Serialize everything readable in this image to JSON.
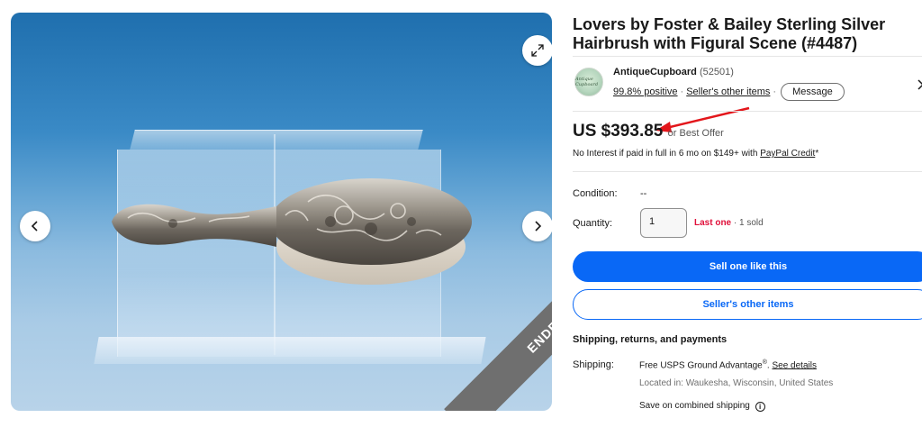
{
  "listing": {
    "title": "Lovers by Foster & Bailey Sterling Silver Hairbrush with Figural Scene (#4487)",
    "ended_label": "ENDED"
  },
  "seller": {
    "name": "AntiqueCupboard",
    "feedback_count": "(52501)",
    "positive": "99.8% positive",
    "separator": "·",
    "other_items_link": "Seller's other items",
    "message_button": "Message",
    "avatar_text": "Antique Cupboard"
  },
  "price": {
    "amount": "US $393.85",
    "best_offer": "or Best Offer",
    "interest_text": "No Interest if paid in full in 6 mo on $149+ with ",
    "paypal_link": "PayPal Credit",
    "asterisk": "*"
  },
  "details": {
    "condition_label": "Condition:",
    "condition_value": "--",
    "quantity_label": "Quantity:",
    "quantity_value": "1",
    "last_one": "Last one",
    "sold_text": " · 1 sold"
  },
  "buttons": {
    "sell_one": "Sell one like this",
    "seller_items": "Seller's other items"
  },
  "shipping": {
    "heading": "Shipping, returns, and payments",
    "shipping_label": "Shipping:",
    "service": "Free USPS Ground Advantage",
    "registered": "®",
    "period": ".",
    "see_details": "See details",
    "location": "Located in: Waukesha, Wisconsin, United States",
    "combined": "Save on combined shipping",
    "info_glyph": "i"
  },
  "colors": {
    "primary_blue": "#0968f6",
    "alert_red": "#e0103a",
    "ribbon_gray": "#6f6f6f"
  },
  "icons": [
    "chevron-left-icon",
    "chevron-right-icon",
    "expand-icon",
    "info-icon",
    "chevron-right-seller-icon"
  ]
}
